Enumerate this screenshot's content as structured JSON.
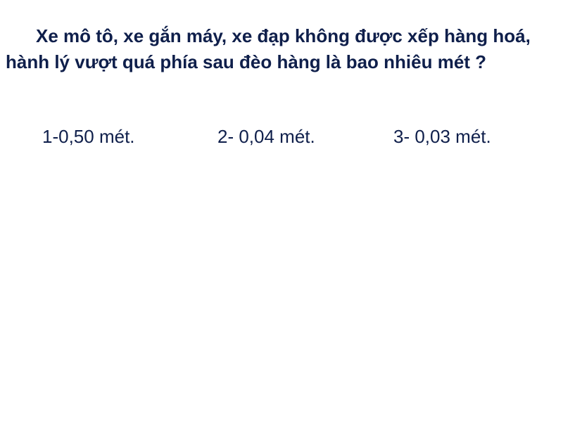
{
  "question": {
    "text": "Xe mô tô, xe gắn máy, xe đạp không được xếp hàng hoá, hành lý vượt quá phía sau đèo hàng là bao nhiêu mét ?"
  },
  "answers": [
    {
      "label": "1-0,50 mét."
    },
    {
      "label": "2- 0,04 mét."
    },
    {
      "label": "3- 0,03 mét."
    }
  ],
  "colors": {
    "text": "#0f1f4b",
    "background": "#ffffff"
  }
}
